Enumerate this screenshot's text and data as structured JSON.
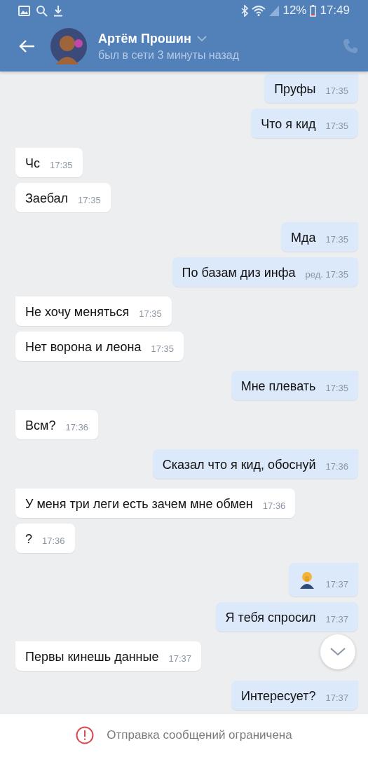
{
  "status_bar": {
    "battery": "12%",
    "time": "17:49"
  },
  "header": {
    "name": "Артём Прошин",
    "status": "был в сети 3 минуты назад"
  },
  "messages": [
    {
      "outgoing": true,
      "kind": "text",
      "text": "Пруфы",
      "time": "17:35",
      "edited": false
    },
    {
      "outgoing": true,
      "kind": "text",
      "text": "Что я кид",
      "time": "17:35",
      "edited": false
    },
    {
      "outgoing": false,
      "kind": "text",
      "text": "Чс",
      "time": "17:35",
      "edited": false
    },
    {
      "outgoing": false,
      "kind": "text",
      "text": "Заебал",
      "time": "17:35",
      "edited": false
    },
    {
      "outgoing": true,
      "kind": "text",
      "text": "Мда",
      "time": "17:35",
      "edited": false
    },
    {
      "outgoing": true,
      "kind": "text",
      "text": "По базам диз инфа",
      "time": "17:35",
      "edited": true,
      "edited_label": "ред."
    },
    {
      "outgoing": false,
      "kind": "text",
      "text": "Не хочу меняться",
      "time": "17:35",
      "edited": false
    },
    {
      "outgoing": false,
      "kind": "text",
      "text": "Нет ворона и леона",
      "time": "17:35",
      "edited": false
    },
    {
      "outgoing": true,
      "kind": "text",
      "text": "Мне плевать",
      "time": "17:35",
      "edited": false
    },
    {
      "outgoing": false,
      "kind": "text",
      "text": "Всм?",
      "time": "17:36",
      "edited": false
    },
    {
      "outgoing": true,
      "kind": "text",
      "text": "Сказал что я кид, обоснуй",
      "time": "17:36",
      "edited": false
    },
    {
      "outgoing": false,
      "kind": "text",
      "text": "У меня три леги есть зачем мне обмен",
      "time": "17:36",
      "edited": false
    },
    {
      "outgoing": false,
      "kind": "text",
      "text": "?",
      "time": "17:36",
      "edited": false
    },
    {
      "outgoing": true,
      "kind": "emoji",
      "time": "17:37",
      "edited": false
    },
    {
      "outgoing": true,
      "kind": "text",
      "text": "Я тебя спросил",
      "time": "17:37",
      "edited": false
    },
    {
      "outgoing": false,
      "kind": "text",
      "text": "Первы кинешь данные",
      "time": "17:37",
      "edited": false
    },
    {
      "outgoing": true,
      "kind": "text",
      "text": "Интересует?",
      "time": "17:37",
      "edited": false
    }
  ],
  "footer": {
    "notice": "Отправка сообщений ограничена"
  }
}
